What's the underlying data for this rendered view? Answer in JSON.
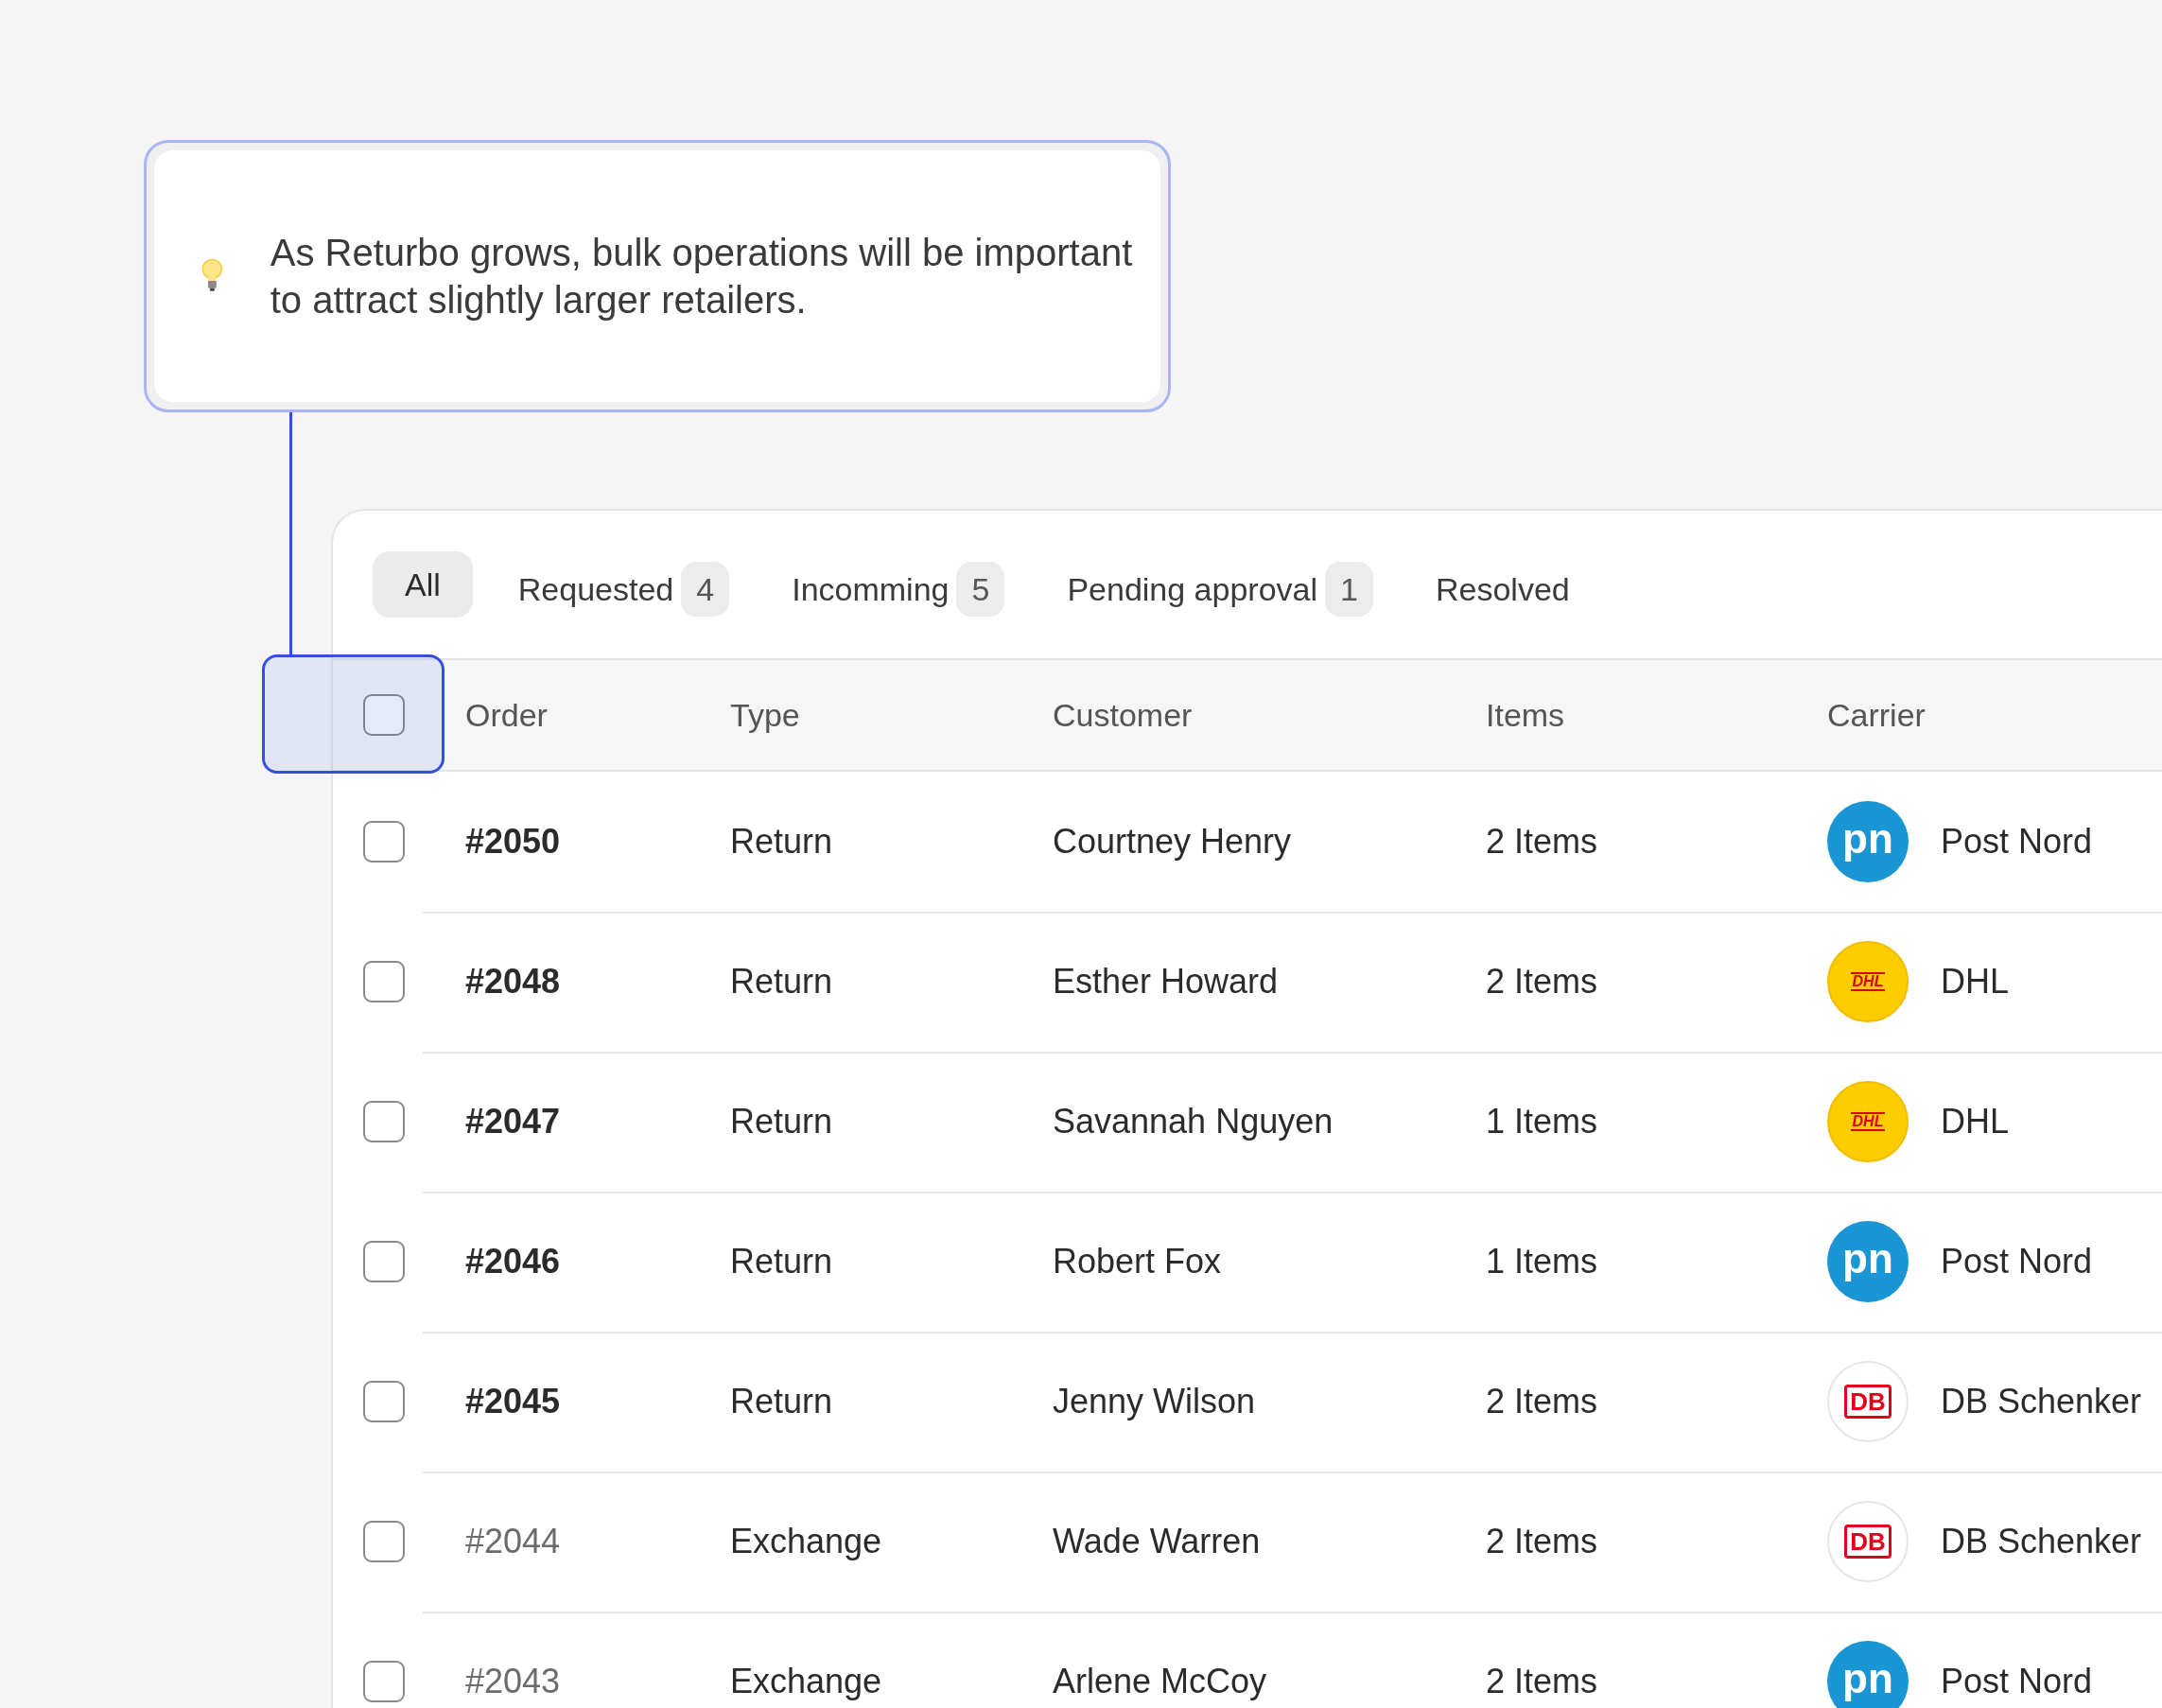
{
  "callout": {
    "text": "As Returbo grows, bulk operations will be important to attract slightly larger retailers."
  },
  "tabs": [
    {
      "label": "All",
      "selected": true
    },
    {
      "label": "Requested",
      "count": "4",
      "selected": false
    },
    {
      "label": "Incomming",
      "count": "5",
      "selected": false
    },
    {
      "label": "Pending approval",
      "count": "1",
      "selected": false
    },
    {
      "label": "Resolved",
      "selected": false
    }
  ],
  "table": {
    "select_all": {
      "checked": false,
      "highlighted": true
    },
    "columns": [
      "Order",
      "Type",
      "Customer",
      "Items",
      "Carrier"
    ],
    "rows": [
      {
        "checked": false,
        "dimmed": false,
        "order": "#2050",
        "type": "Return",
        "customer": "Courtney Henry",
        "items": "2 Items",
        "carrier": {
          "kind": "postnord",
          "logo_text": "pn",
          "name": "Post Nord"
        }
      },
      {
        "checked": false,
        "dimmed": false,
        "order": "#2048",
        "type": "Return",
        "customer": "Esther Howard",
        "items": "2 Items",
        "carrier": {
          "kind": "dhl",
          "logo_text": "DHL",
          "name": "DHL"
        }
      },
      {
        "checked": false,
        "dimmed": false,
        "order": "#2047",
        "type": "Return",
        "customer": "Savannah Nguyen",
        "items": "1 Items",
        "carrier": {
          "kind": "dhl",
          "logo_text": "DHL",
          "name": "DHL"
        }
      },
      {
        "checked": false,
        "dimmed": false,
        "order": "#2046",
        "type": "Return",
        "customer": "Robert Fox",
        "items": "1 Items",
        "carrier": {
          "kind": "postnord",
          "logo_text": "pn",
          "name": "Post Nord"
        }
      },
      {
        "checked": false,
        "dimmed": false,
        "order": "#2045",
        "type": "Return",
        "customer": "Jenny Wilson",
        "items": "2 Items",
        "carrier": {
          "kind": "db",
          "logo_text": "DB",
          "name": "DB Schenker"
        }
      },
      {
        "checked": false,
        "dimmed": true,
        "order": "#2044",
        "type": "Exchange",
        "customer": "Wade Warren",
        "items": "2 Items",
        "carrier": {
          "kind": "db",
          "logo_text": "DB",
          "name": "DB Schenker"
        }
      },
      {
        "checked": false,
        "dimmed": true,
        "order": "#2043",
        "type": "Exchange",
        "customer": "Arlene McCoy",
        "items": "2 Items",
        "carrier": {
          "kind": "postnord",
          "logo_text": "pn",
          "name": "Post Nord"
        }
      }
    ]
  }
}
